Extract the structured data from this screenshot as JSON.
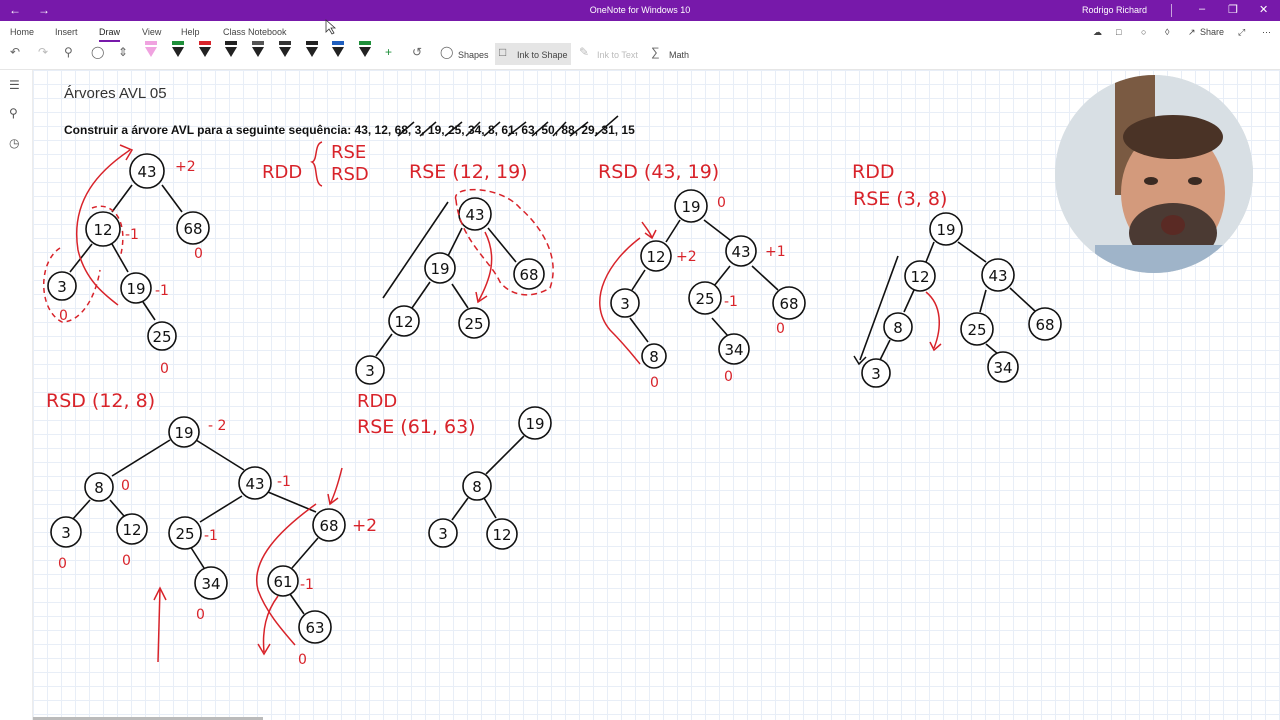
{
  "titlebar": {
    "title": "OneNote for Windows 10",
    "user": "Rodrigo Richard",
    "back_icon": "arrow-left-icon",
    "forward_icon": "arrow-right-icon",
    "accent": "#7719aa"
  },
  "ribbon": {
    "tabs": [
      "Home",
      "Insert",
      "Draw",
      "View",
      "Help",
      "Class Notebook"
    ],
    "active_tab": "Draw",
    "right_tools": {
      "share": "Share"
    },
    "buttons": {
      "shapes": "Shapes",
      "ink_to_shape": "Ink to Shape",
      "ink_to_text": "Ink to Text",
      "math": "Math"
    },
    "pen_colors": [
      "#f0a3e0",
      "#1e8f3a",
      "#d8232a",
      "#222222",
      "#222222",
      "#222222",
      "#222222",
      "#1f5fbf",
      "#1e8f3a"
    ]
  },
  "page": {
    "title": "Árvores AVL 05",
    "instruction": "Construir a árvore AVL para a seguinte sequência: 43, 12, 68, 3, 19, 25, 34, 8, 61, 63, 50, 88, 29, 31, 15"
  },
  "ink_labels": {
    "rdd": "RDD",
    "rse": "RSE",
    "rsd": "RSD",
    "rse_12_19": "RSE (12, 19)",
    "rsd_43_19": "RSD (43, 19)",
    "rdd2": "RDD",
    "rse_3_8": "RSE (3, 8)",
    "rsd_12_8": "RSD (12, 8)",
    "rdd3": "RDD",
    "rse_61_63": "RSE (61, 63)",
    "bf_plus2": "+2",
    "bf_minus1": "-1",
    "bf_plus1": "+1",
    "bf_minus2": "- 2",
    "bf_zero": "0"
  },
  "tree_nodes": {
    "t1": [
      "43",
      "12",
      "68",
      "3",
      "19",
      "25"
    ],
    "t2": [
      "43",
      "19",
      "68",
      "12",
      "25",
      "3"
    ],
    "t3": [
      "19",
      "12",
      "43",
      "3",
      "25",
      "68",
      "8",
      "34"
    ],
    "t4": [
      "19",
      "12",
      "43",
      "8",
      "25",
      "68",
      "3",
      "34"
    ],
    "t5": [
      "19",
      "8",
      "43",
      "3",
      "12",
      "25",
      "68",
      "34",
      "61",
      "63"
    ],
    "t6": [
      "19",
      "8",
      "3",
      "12"
    ]
  }
}
